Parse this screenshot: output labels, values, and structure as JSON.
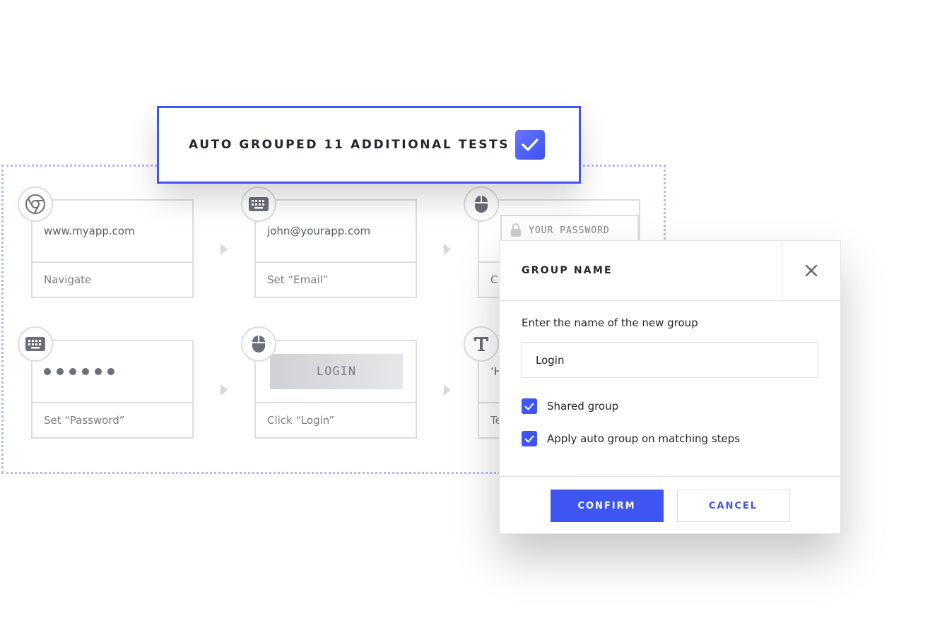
{
  "banner": {
    "text": "AUTO GROUPED 11 ADDITIONAL TESTS"
  },
  "steps": [
    {
      "icon": "chrome-icon",
      "value": "www.myapp.com",
      "action": "Navigate"
    },
    {
      "icon": "keyboard-icon",
      "value": "john@yourapp.com",
      "action": "Set “Email”"
    },
    {
      "icon": "mouse-icon",
      "value": "YOUR PASSWORD",
      "action": "C"
    },
    {
      "icon": "keyboard-icon",
      "value": "●●●●●●",
      "action": "Set “Password”"
    },
    {
      "icon": "mouse-icon",
      "value": "LOGIN",
      "action": "Click “Login”"
    },
    {
      "icon": "text-icon",
      "value": "‘H",
      "action": "Te"
    }
  ],
  "dialog": {
    "title": "GROUP NAME",
    "label": "Enter the name of the new group",
    "input_value": "Login",
    "options": [
      {
        "label": "Shared group",
        "checked": true
      },
      {
        "label": "Apply auto group on matching steps",
        "checked": true
      }
    ],
    "confirm_label": "CONFIRM",
    "cancel_label": "CANCEL"
  },
  "colors": {
    "accent": "#3e55f2",
    "border": "#dcdde1",
    "dotted": "#b4b9f5"
  }
}
